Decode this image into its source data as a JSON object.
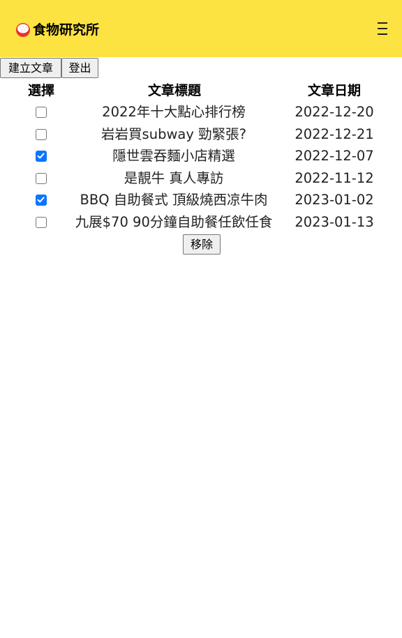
{
  "header": {
    "title": "食物研究所",
    "logo_icon": "rice-ball-icon",
    "menu_icon": "hamburger-menu-icon",
    "background": "#fde342"
  },
  "toolbar": {
    "create_label": "建立文章",
    "logout_label": "登出"
  },
  "table": {
    "headers": {
      "select": "選擇",
      "title": "文章標題",
      "date": "文章日期"
    },
    "rows": [
      {
        "title": "2022年十大點心排行榜",
        "date": "2022-12-20",
        "checked": false
      },
      {
        "title": "岩岩買subway 勁緊張?",
        "date": "2022-12-21",
        "checked": false
      },
      {
        "title": "隱世雲吞麵小店精選",
        "date": "2022-12-07",
        "checked": true
      },
      {
        "title": "是靚牛 真人專訪",
        "date": "2022-11-12",
        "checked": false
      },
      {
        "title": "BBQ 自助餐式 頂級燒西凉牛肉",
        "date": "2023-01-02",
        "checked": true
      },
      {
        "title": "九展$70 90分鐘自助餐任飲任食",
        "date": "2023-01-13",
        "checked": false
      }
    ]
  },
  "actions": {
    "remove_label": "移除"
  },
  "colors": {
    "checkbox_checked": "#0b75ff"
  }
}
